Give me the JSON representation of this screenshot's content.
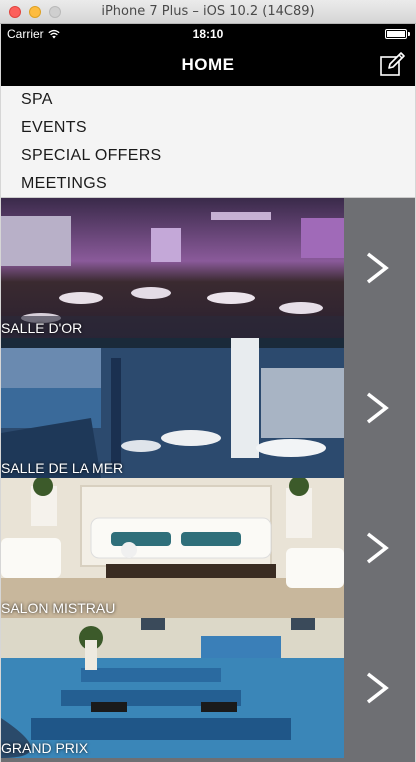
{
  "window": {
    "title": "iPhone 7 Plus – iOS 10.2 (14C89)"
  },
  "statusbar": {
    "carrier": "Carrier",
    "time": "18:10",
    "battery_level": 1.0
  },
  "navbar": {
    "title": "HOME",
    "compose_icon": "compose-icon"
  },
  "menu": {
    "items": [
      {
        "label": "SPA"
      },
      {
        "label": "EVENTS"
      },
      {
        "label": "SPECIAL OFFERS"
      },
      {
        "label": "MEETINGS"
      }
    ]
  },
  "rooms": [
    {
      "name": "SALLE D'OR",
      "icon": "chevron-right-icon"
    },
    {
      "name": "SALLE DE LA MER",
      "icon": "chevron-right-icon"
    },
    {
      "name": "SALON MISTRAU",
      "icon": "chevron-right-icon"
    },
    {
      "name": "GRAND PRIX",
      "icon": "chevron-right-icon"
    }
  ],
  "colors": {
    "bar_background": "#000000",
    "menu_background": "#f4f4f4",
    "list_side": "#6e6f73"
  }
}
